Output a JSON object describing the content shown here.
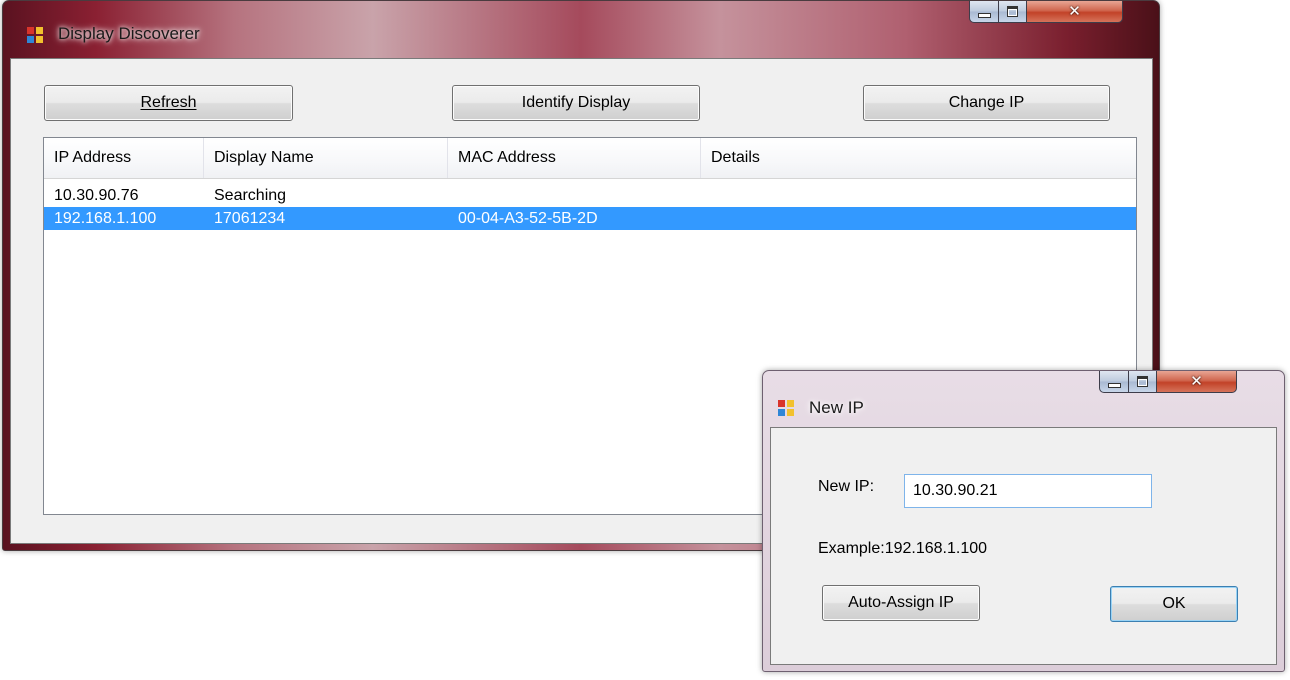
{
  "main_window": {
    "title": "Display Discoverer",
    "toolbar": {
      "refresh_label": "Refresh",
      "identify_label": "Identify Display",
      "change_ip_label": "Change IP"
    },
    "list": {
      "columns": [
        "IP Address",
        "Display Name",
        "MAC Address",
        "Details"
      ],
      "rows": [
        {
          "ip": "10.30.90.76",
          "name": "Searching",
          "mac": "",
          "details": "",
          "selected": false
        },
        {
          "ip": "192.168.1.100",
          "name": "17061234",
          "mac": "00-04-A3-52-5B-2D",
          "details": "",
          "selected": true
        }
      ]
    }
  },
  "dialog": {
    "title": "New IP",
    "new_ip_label": "New IP:",
    "new_ip_value": "10.30.90.21",
    "example_text": "Example:192.168.1.100",
    "auto_assign_label": "Auto-Assign IP",
    "ok_label": "OK"
  },
  "colors": {
    "selection": "#3399ff",
    "close_button": "#c24228",
    "window_face": "#f0f0f0"
  },
  "icons": [
    "app-icon",
    "minimize-icon",
    "maximize-icon",
    "close-icon"
  ]
}
